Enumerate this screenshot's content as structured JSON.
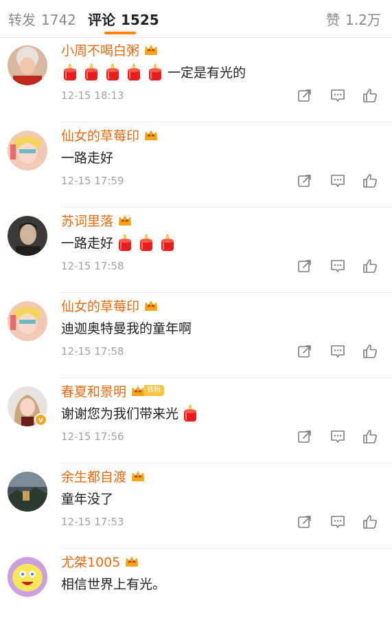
{
  "tabs": [
    {
      "label": "转发",
      "count": "1742"
    },
    {
      "label": "评论",
      "count": "1525"
    },
    {
      "label": "赞",
      "count": "1.2万"
    }
  ],
  "colors": {
    "accent": "#ff8200",
    "username": "#e86b0f",
    "candle": "#e81e1e"
  },
  "comments": [
    {
      "username": "小周不喝白粥",
      "text": "一定是有光的",
      "candles_before": 5,
      "candles_after": 0,
      "time": "12-15 18:13",
      "badge": "",
      "verified": false
    },
    {
      "username": "仙女的草莓印",
      "text": "一路走好",
      "candles_before": 0,
      "candles_after": 0,
      "time": "12-15 17:59",
      "badge": "",
      "verified": false
    },
    {
      "username": "苏词里落",
      "text": "一路走好",
      "candles_before": 0,
      "candles_after": 3,
      "time": "12-15 17:58",
      "badge": "",
      "verified": false
    },
    {
      "username": "仙女的草莓印",
      "text": "迪迦奥特曼我的童年啊",
      "candles_before": 0,
      "candles_after": 0,
      "time": "12-15 17:58",
      "badge": "",
      "verified": false
    },
    {
      "username": "春夏和景明",
      "text": "谢谢您为我们带来光",
      "candles_before": 0,
      "candles_after": 1,
      "time": "12-15 17:56",
      "badge": "铁粉",
      "verified": true
    },
    {
      "username": "余生都自渡",
      "text": "童年没了",
      "candles_before": 0,
      "candles_after": 0,
      "time": "12-15 17:53",
      "badge": "",
      "verified": false
    },
    {
      "username": "尤桀1005",
      "text": "相信世界上有光。",
      "candles_before": 0,
      "candles_after": 0,
      "time": "",
      "badge": "",
      "verified": false
    }
  ],
  "icons": {
    "share": "share-icon",
    "reply": "comment-icon",
    "like": "thumbs-up-icon",
    "crown": "crown-icon",
    "candle": "candle-icon"
  }
}
